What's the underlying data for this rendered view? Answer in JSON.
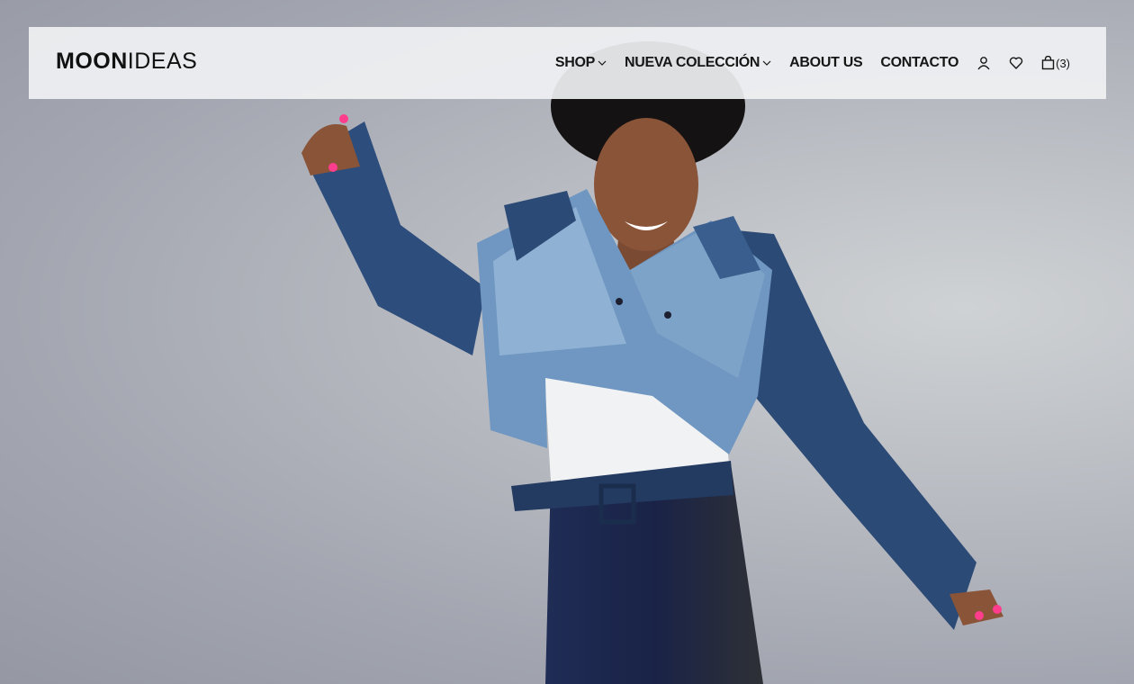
{
  "brand": {
    "logo_bold": "MOON",
    "logo_light": "IDEAS"
  },
  "nav": {
    "items": [
      {
        "label": "SHOP",
        "has_dropdown": true
      },
      {
        "label": "NUEVA COLECCIÓN",
        "has_dropdown": true
      },
      {
        "label": "ABOUT US",
        "has_dropdown": false
      },
      {
        "label": "CONTACTO",
        "has_dropdown": false
      }
    ],
    "icons": {
      "account": "user-icon",
      "wishlist": "heart-icon",
      "cart": "shopping-bag-icon"
    },
    "cart_count": "(3)"
  },
  "hero": {
    "image": "model-in-patchwork-denim-jacket",
    "background_color": "#a8abb4"
  }
}
